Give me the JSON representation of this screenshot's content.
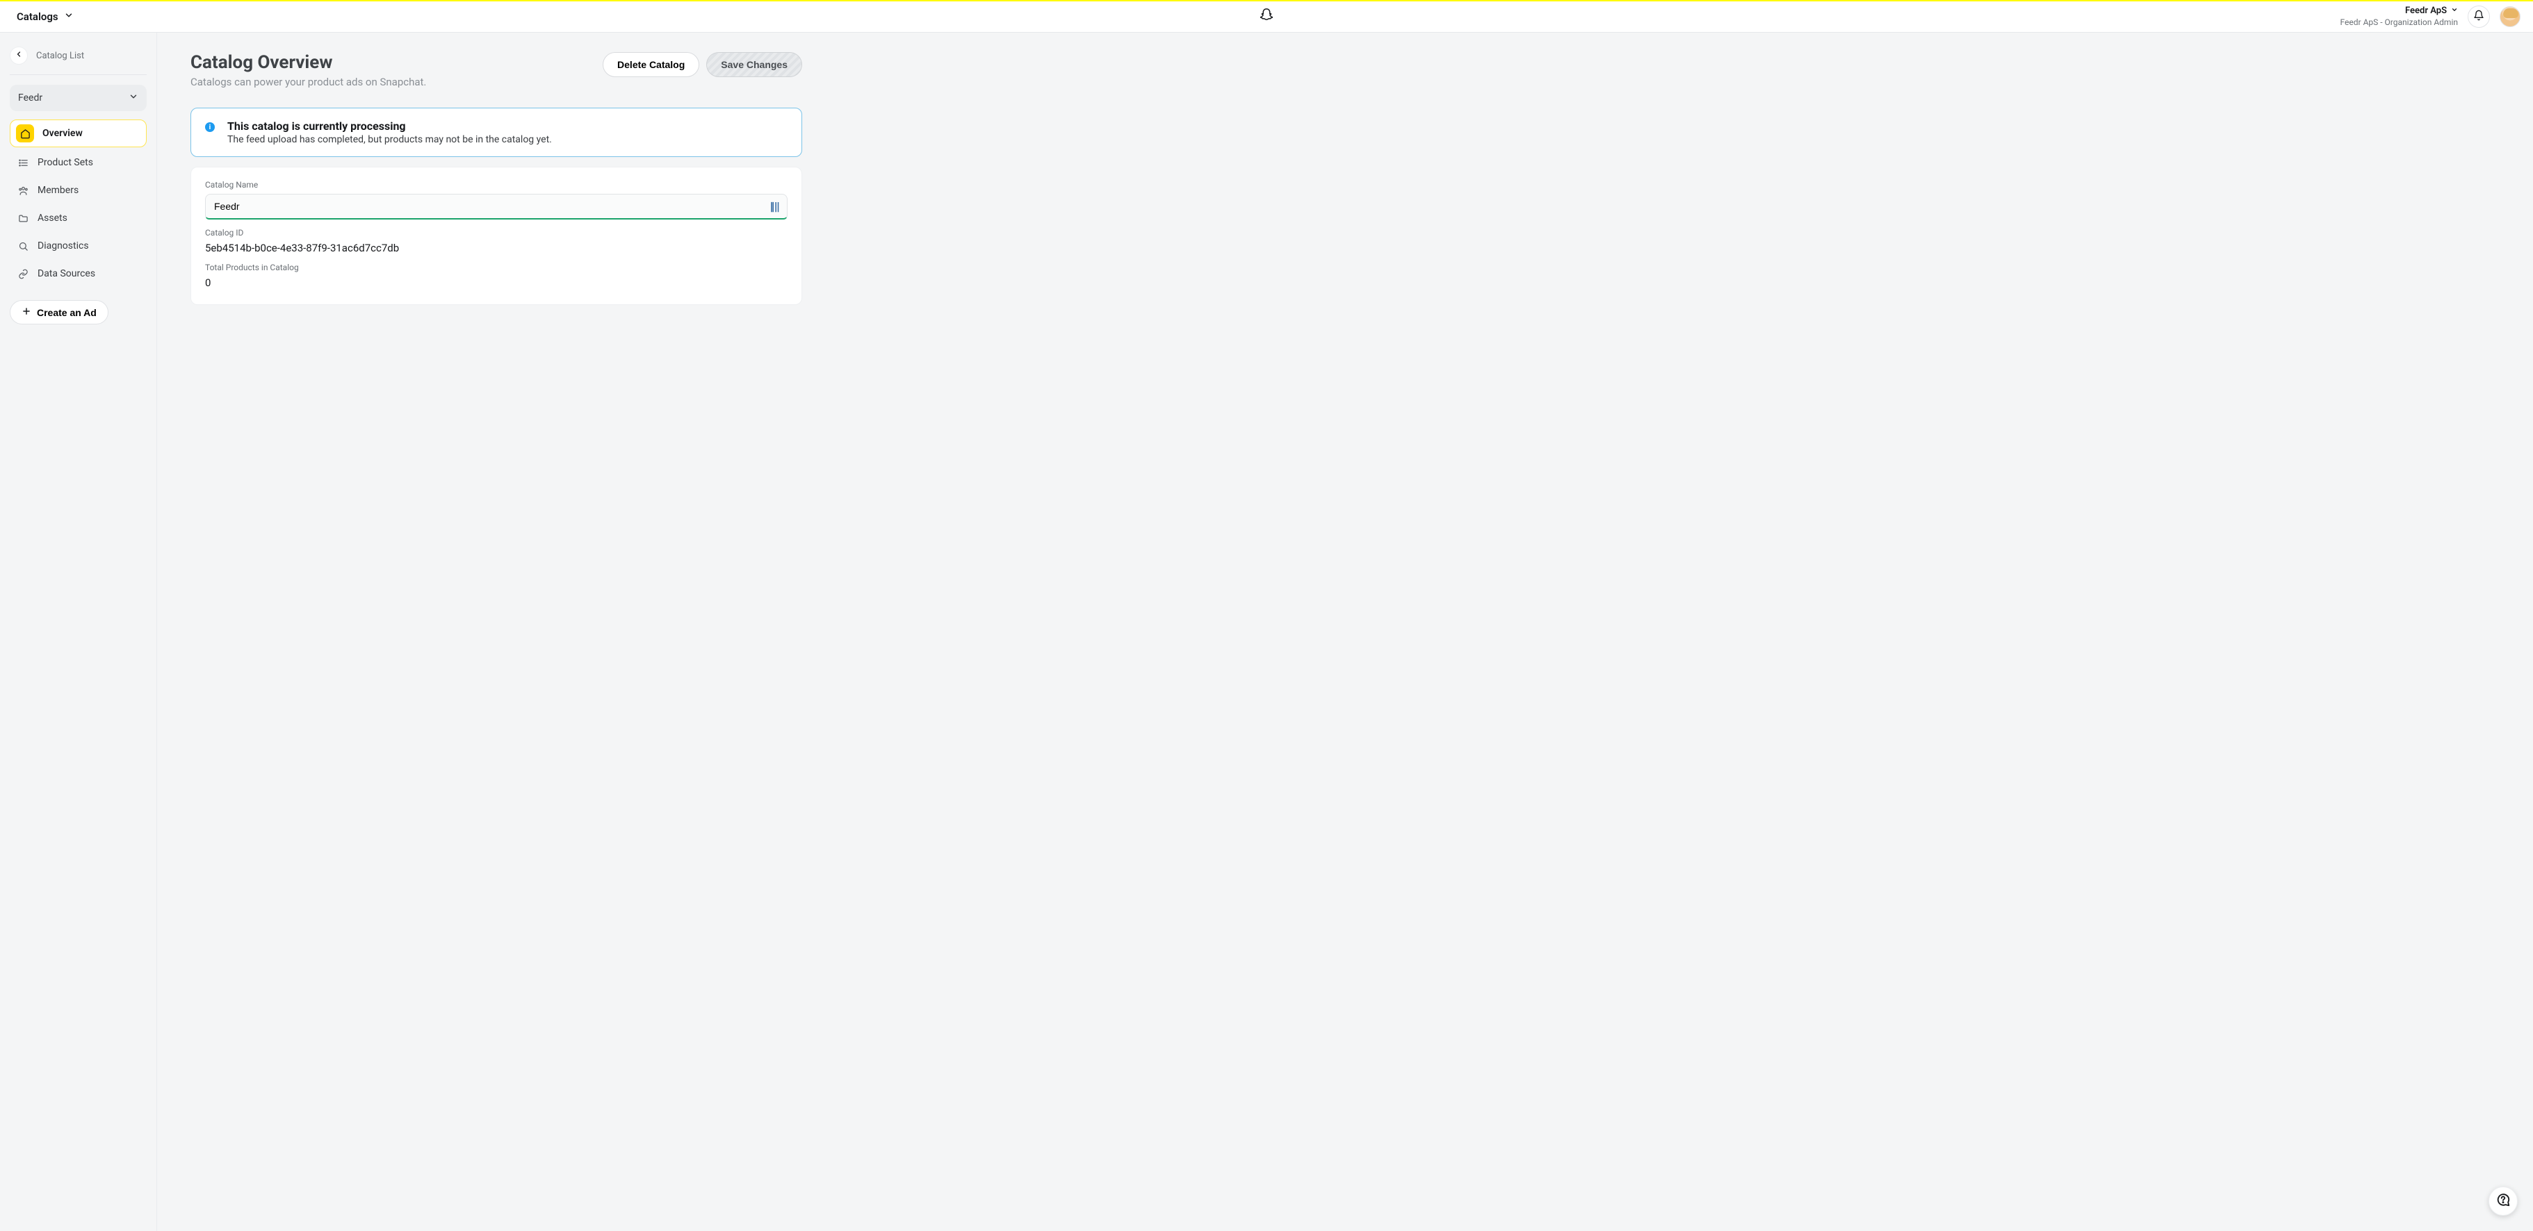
{
  "topbar": {
    "section": "Catalogs",
    "org_name": "Feedr ApS",
    "org_role": "Feedr ApS - Organization Admin"
  },
  "sidebar": {
    "back_label": "Catalog List",
    "selected_catalog": "Feedr",
    "items": [
      {
        "label": "Overview"
      },
      {
        "label": "Product Sets"
      },
      {
        "label": "Members"
      },
      {
        "label": "Assets"
      },
      {
        "label": "Diagnostics"
      },
      {
        "label": "Data Sources"
      }
    ],
    "create_ad": "Create an Ad"
  },
  "page": {
    "title": "Catalog Overview",
    "subtitle": "Catalogs can power your product ads on Snapchat.",
    "delete_btn": "Delete Catalog",
    "save_btn": "Save Changes"
  },
  "banner": {
    "title": "This catalog is currently processing",
    "body": "The feed upload has completed, but products may not be in the catalog yet."
  },
  "form": {
    "name_label": "Catalog Name",
    "name_value": "Feedr",
    "id_label": "Catalog ID",
    "id_value": "5eb4514b-b0ce-4e33-87f9-31ac6d7cc7db",
    "total_label": "Total Products in Catalog",
    "total_value": "0"
  }
}
